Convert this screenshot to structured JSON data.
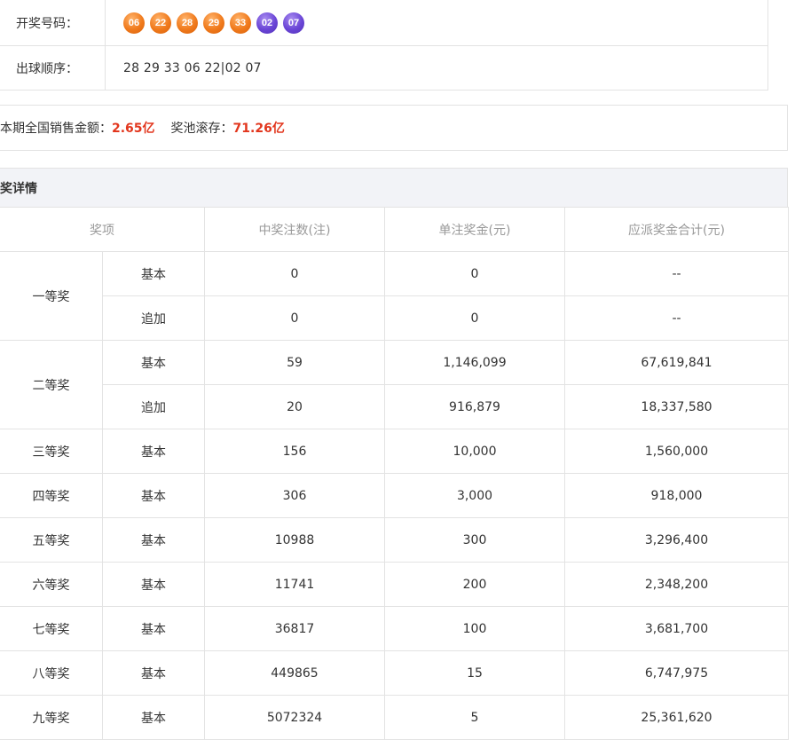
{
  "draw": {
    "numbers_label": "开奖号码：",
    "red_balls": [
      "06",
      "22",
      "28",
      "29",
      "33"
    ],
    "blue_balls": [
      "02",
      "07"
    ],
    "order_label": "出球顺序：",
    "order_value": "28 29 33 06 22|02 07",
    "colors": {
      "red_ball": "#f07a1c",
      "blue_ball": "#6a45d6"
    }
  },
  "sales": {
    "sales_label": "本期全国销售金额：",
    "sales_value": "2.65亿",
    "pool_label": "奖池滚存：",
    "pool_value": "71.26亿",
    "accent_color": "#e2361d"
  },
  "detail": {
    "title": "奖详情",
    "headers": {
      "item": "奖项",
      "count": "中奖注数(注)",
      "unit": "单注奖金(元)",
      "total": "应派奖金合计(元)"
    },
    "rows": [
      {
        "prize": "一等奖",
        "type": "基本",
        "count": "0",
        "unit": "0",
        "total": "--"
      },
      {
        "prize": "",
        "type": "追加",
        "count": "0",
        "unit": "0",
        "total": "--"
      },
      {
        "prize": "二等奖",
        "type": "基本",
        "count": "59",
        "unit": "1,146,099",
        "total": "67,619,841"
      },
      {
        "prize": "",
        "type": "追加",
        "count": "20",
        "unit": "916,879",
        "total": "18,337,580"
      },
      {
        "prize": "三等奖",
        "type": "基本",
        "count": "156",
        "unit": "10,000",
        "total": "1,560,000"
      },
      {
        "prize": "四等奖",
        "type": "基本",
        "count": "306",
        "unit": "3,000",
        "total": "918,000"
      },
      {
        "prize": "五等奖",
        "type": "基本",
        "count": "10988",
        "unit": "300",
        "total": "3,296,400"
      },
      {
        "prize": "六等奖",
        "type": "基本",
        "count": "11741",
        "unit": "200",
        "total": "2,348,200"
      },
      {
        "prize": "七等奖",
        "type": "基本",
        "count": "36817",
        "unit": "100",
        "total": "3,681,700"
      },
      {
        "prize": "八等奖",
        "type": "基本",
        "count": "449865",
        "unit": "15",
        "total": "6,747,975"
      },
      {
        "prize": "九等奖",
        "type": "基本",
        "count": "5072324",
        "unit": "5",
        "total": "25,361,620"
      }
    ]
  }
}
